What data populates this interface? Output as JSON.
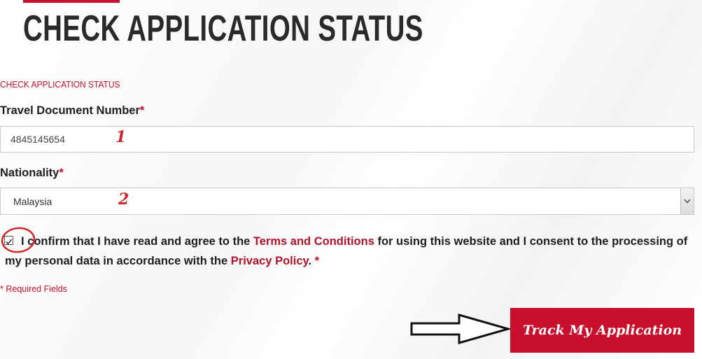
{
  "header": {
    "title": "CHECK APPLICATION STATUS"
  },
  "form": {
    "section_label": "CHECK APPLICATION STATUS",
    "travel_document": {
      "label": "Travel Document Number",
      "required_mark": "*",
      "value": "4845145654"
    },
    "nationality": {
      "label": "Nationality",
      "required_mark": "*",
      "selected": "Malaysia"
    },
    "consent": {
      "checked": true,
      "text_before_terms": "I confirm that I have read and agree to the ",
      "terms_link": "Terms and Conditions",
      "text_middle": " for using this website and I consent to the processing of my personal data in accordance with the ",
      "privacy_link": "Privacy Policy",
      "text_end": ".",
      "required_mark": " *"
    },
    "required_note": "* Required Fields",
    "submit_label": "Track My Application"
  },
  "annotations": {
    "step1": "1",
    "step2": "2"
  },
  "colors": {
    "accent": "#c8102e",
    "annotation": "#d0282a"
  }
}
